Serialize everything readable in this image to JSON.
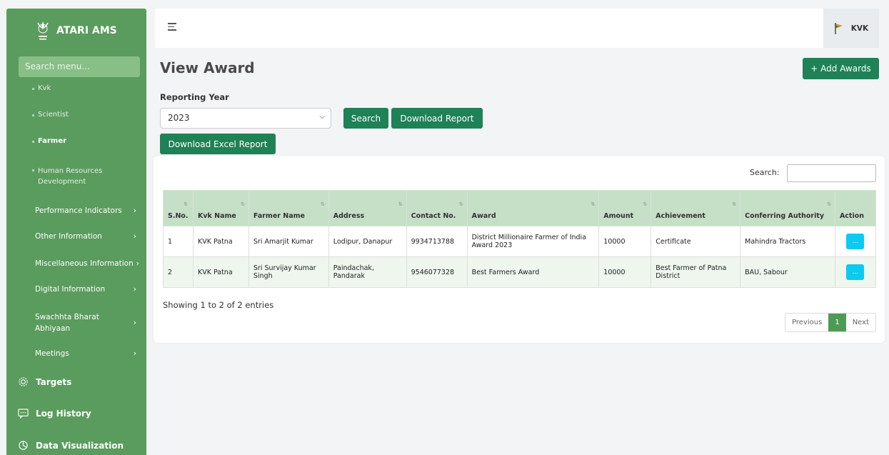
{
  "brand": {
    "title": "ATARI AMS"
  },
  "sidebar": {
    "search_placeholder": "Search menu...",
    "sub_items": [
      {
        "label": "Kvk"
      },
      {
        "label": "Scientist"
      },
      {
        "label": "Farmer"
      },
      {
        "label": "Human Resources Development"
      }
    ],
    "menu_items": [
      {
        "label": "Performance Indicators",
        "chev": "›"
      },
      {
        "label": "Other Information",
        "chev": "›"
      },
      {
        "label": "Miscellaneous Information",
        "chev": "›"
      },
      {
        "label": "Digital Information",
        "chev": "›"
      },
      {
        "label": "Swachhta Bharat Abhiyaan",
        "chev": "›"
      },
      {
        "label": "Meetings",
        "chev": "›"
      }
    ],
    "main_items": [
      {
        "label": "Targets",
        "icon": "gear-icon"
      },
      {
        "label": "Log History",
        "icon": "message-icon"
      },
      {
        "label": "Data Visualization",
        "icon": "chart-icon"
      }
    ]
  },
  "topbar": {
    "user": "KVK"
  },
  "page": {
    "title": "View Award",
    "add_button": "+ Add Awards",
    "year_label": "Reporting Year",
    "year_value": "2023",
    "search_button": "Search",
    "download_button": "Download Report",
    "excel_button": "Download Excel Report"
  },
  "table": {
    "search_label": "Search:",
    "headers": [
      "S.No.",
      "Kvk Name",
      "Farmer Name",
      "Address",
      "Contact No.",
      "Award",
      "Amount",
      "Achievement",
      "Conferring Authority",
      "Action"
    ],
    "rows": [
      [
        "1",
        "KVK Patna",
        "Sri Amarjit Kumar",
        "Lodipur, Danapur",
        "9934713788",
        "District Millionaire Farmer of India Award 2023",
        "10000",
        "Certificate",
        "Mahindra Tractors"
      ],
      [
        "2",
        "KVK Patna",
        "Sri Survijay Kumar Singh",
        "Paindachak, Pandarak",
        "9546077328",
        "Best Farmers Award",
        "10000",
        "Best Farmer of Patna District",
        "BAU, Sabour"
      ]
    ],
    "action_label": "...",
    "info": "Showing 1 to 2 of 2 entries",
    "pager": {
      "prev": "Previous",
      "current": "1",
      "next": "Next"
    }
  },
  "colors": {
    "sidebar": "#5a9c5e",
    "accent": "#1f8156",
    "header_row": "#c6dfc7",
    "action": "#0dcaf0"
  }
}
